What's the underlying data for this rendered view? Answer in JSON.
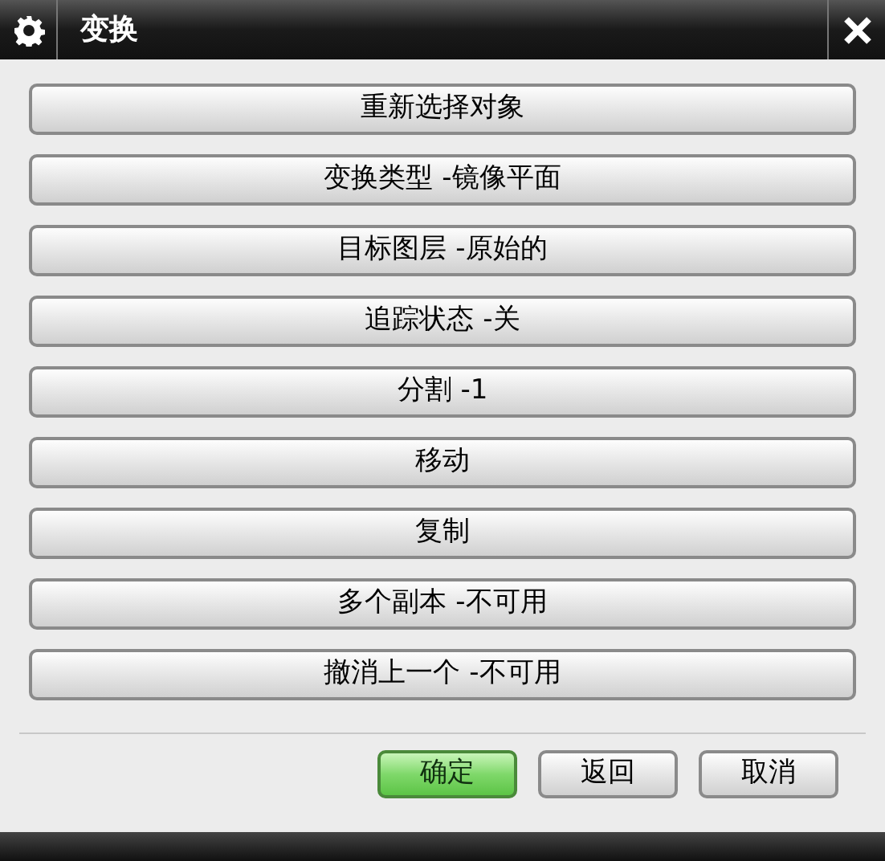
{
  "window": {
    "title": "变换"
  },
  "options": [
    {
      "label": "重新选择对象"
    },
    {
      "label": "变换类型 -镜像平面"
    },
    {
      "label": "目标图层 -原始的"
    },
    {
      "label": "追踪状态 -关"
    },
    {
      "label": "分割 -1"
    },
    {
      "label": "移动"
    },
    {
      "label": "复制"
    },
    {
      "label": "多个副本 -不可用"
    },
    {
      "label": "撤消上一个 -不可用"
    }
  ],
  "buttons": [
    {
      "label": "确定",
      "default": true
    },
    {
      "label": "返回",
      "default": false
    },
    {
      "label": "取消",
      "default": false
    }
  ]
}
